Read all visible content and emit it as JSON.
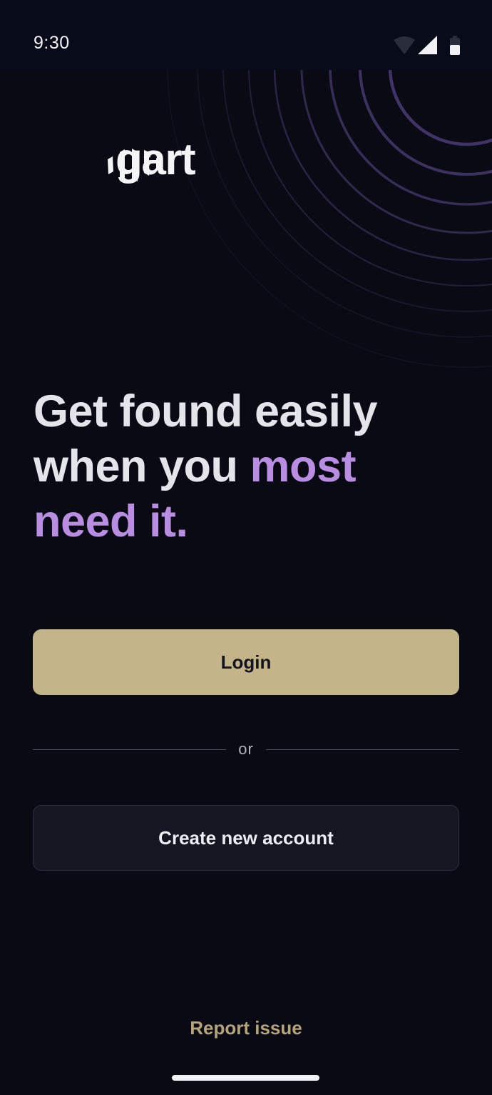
{
  "status_bar": {
    "time": "9:30",
    "icons": [
      "wifi-icon",
      "cellular-signal-icon",
      "battery-icon"
    ]
  },
  "brand": {
    "name": "gart",
    "logo_icon": "sound-wave-bars-icon"
  },
  "headline": {
    "line1": "Get found easily",
    "line2_plain": "when you ",
    "line2_accent": "most",
    "line3_accent": "need it."
  },
  "actions": {
    "login_label": "Login",
    "separator_label": "or",
    "create_account_label": "Create new account",
    "report_issue_label": "Report issue"
  },
  "colors": {
    "background": "#0a0a14",
    "accent_purple": "#b98ee2",
    "login_button": "#c4b48a",
    "report_link": "#b5a37a",
    "ring_stroke": "#4a3b73"
  }
}
